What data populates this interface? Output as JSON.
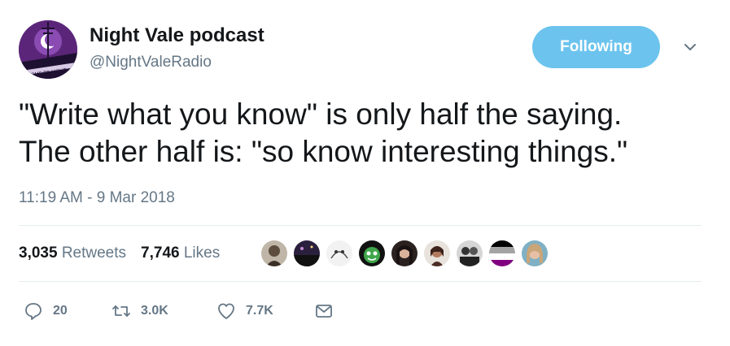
{
  "tweet": {
    "author_name": "Night Vale podcast",
    "author_handle": "@NightValeRadio",
    "avatar_caption": "COME TO NIGHT",
    "follow_label": "Following",
    "text_lines": [
      "\"Write what you know\" is only half the saying.",
      "The other half is: \"so know interesting things.\""
    ],
    "timestamp": "11:19 AM - 9 Mar 2018"
  },
  "stats": {
    "retweets_count": "3,035",
    "retweets_label": "Retweets",
    "likes_count": "7,746",
    "likes_label": "Likes"
  },
  "likers": [
    {
      "icon": "avatar-bearded-man",
      "color": "#7b6b5a"
    },
    {
      "icon": "avatar-night-sky",
      "color": "#2a1f3d"
    },
    {
      "icon": "avatar-sketch",
      "color": "#e8e8e8"
    },
    {
      "icon": "avatar-cartoon-green",
      "color": "#2d7a34"
    },
    {
      "icon": "avatar-dark-hair",
      "color": "#3a2d2a"
    },
    {
      "icon": "avatar-portrait",
      "color": "#5a3b32"
    },
    {
      "icon": "avatar-group",
      "color": "#4a4a4a"
    },
    {
      "icon": "avatar-ace-flag",
      "color": "#800080"
    },
    {
      "icon": "avatar-blonde",
      "color": "#c9a578"
    }
  ],
  "actions": {
    "reply_count": "20",
    "retweet_count": "3.0K",
    "like_count": "7.7K"
  },
  "colors": {
    "follow_button": "#6cc4ee",
    "secondary_text": "#657786",
    "avatar_purple": "#6a2c8e"
  }
}
